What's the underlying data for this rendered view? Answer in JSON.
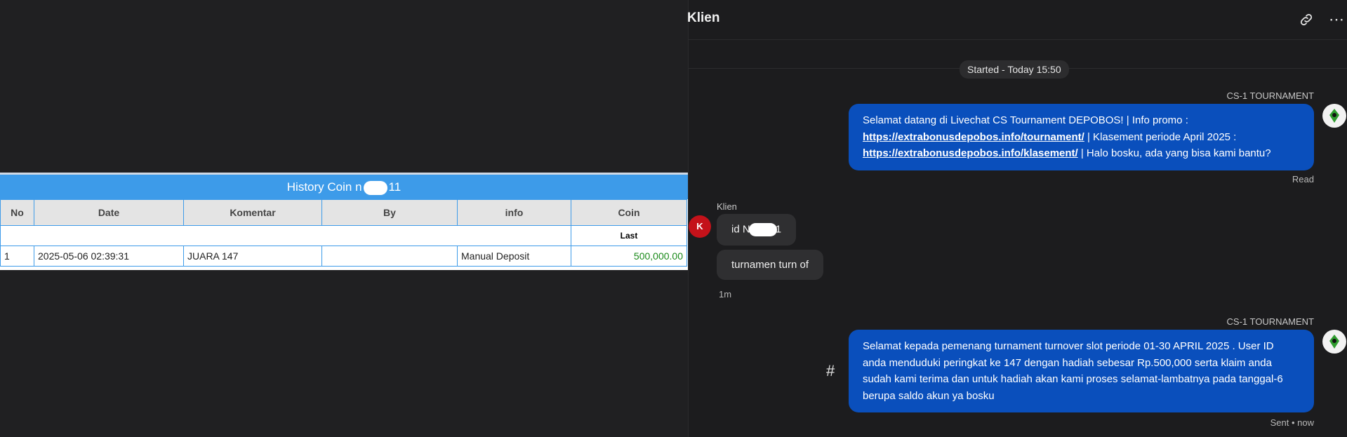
{
  "history": {
    "title_prefix": "History Coin n",
    "title_suffix": "11",
    "columns": [
      "No",
      "Date",
      "Komentar",
      "By",
      "info",
      "Coin"
    ],
    "sub_header": "Last",
    "rows": [
      {
        "no": "1",
        "date": "2025-05-06 02:39:31",
        "komentar": "JUARA 147",
        "by": "",
        "info": "Manual Deposit",
        "coin": "500,000.00"
      }
    ]
  },
  "chat": {
    "title": "Klien",
    "link_icon": "link-icon",
    "more_icon": "more-icon",
    "more_label": "⋯",
    "started": "Started - Today 15:50",
    "messages": {
      "agent1": {
        "sender": "CS-1 TOURNAMENT",
        "line1": "Selamat datang di Livechat CS Tournament DEPOBOS! | Info promo :",
        "link1": "https://extrabonusdepobos.info/tournament/",
        "line2_rest": " | Klasement periode April 2025 :",
        "link2": "https://extrabonusdepobos.info/klasement/",
        "line3_rest": " | Halo bosku, ada yang bisa kami bantu?",
        "status": "Read"
      },
      "user": {
        "sender": "Klien",
        "avatar_letter": "K",
        "bubble1_prefix": "id N",
        "bubble1_suffix": "1",
        "bubble2": "turnamen turn of",
        "time": "1m"
      },
      "agent2": {
        "sender": "CS-1 TOURNAMENT",
        "text": "Selamat kepada pemenang turnament turnover slot periode 01-30 APRIL 2025 . User ID anda menduduki peringkat ke 147 dengan hadiah sebesar Rp.500,000 serta klaim anda sudah kami terima dan untuk hadiah akan kami proses selamat-lambatnya pada tanggal-6 berupa saldo akun ya bosku",
        "status": "Sent • now"
      }
    },
    "hash_label": "#"
  }
}
